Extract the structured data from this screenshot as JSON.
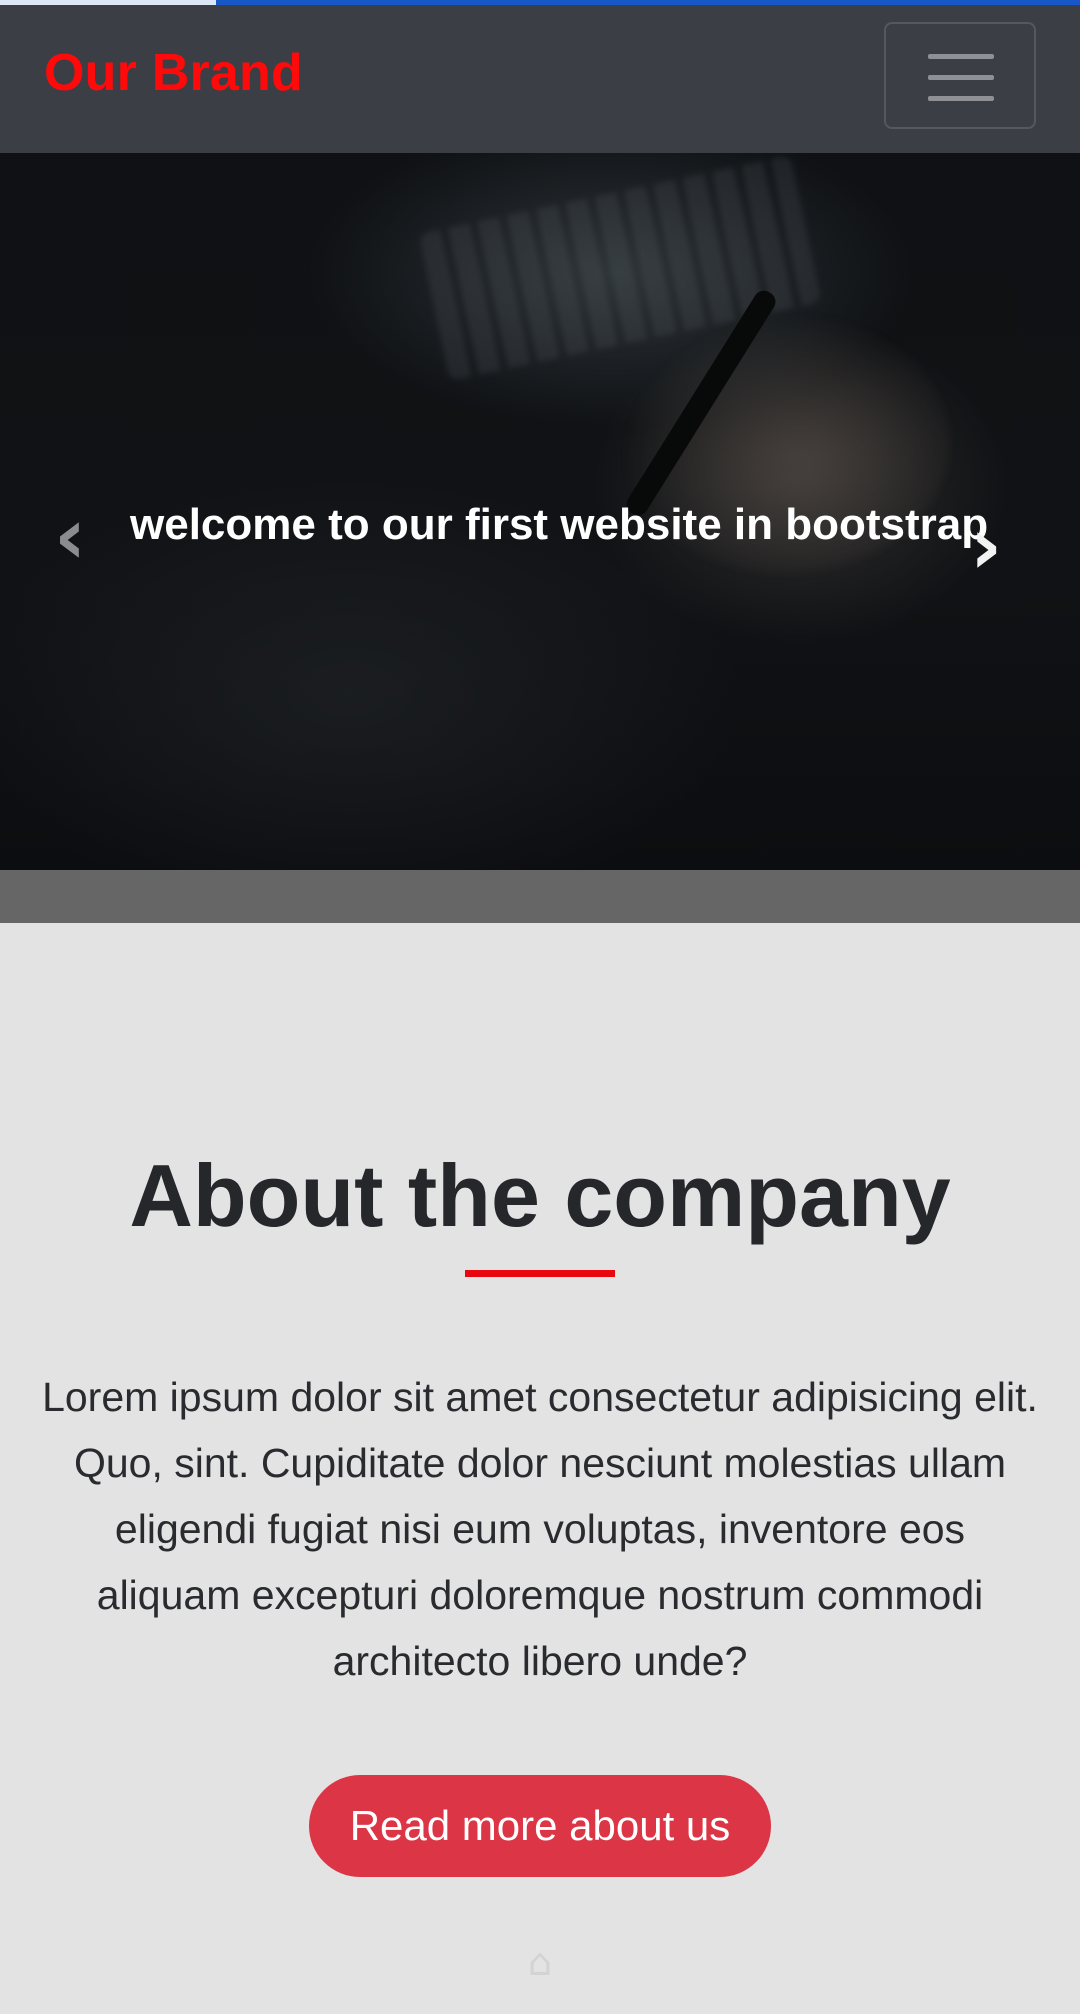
{
  "page_loader": {
    "progress": 0.2
  },
  "navbar": {
    "brand": "Our Brand",
    "brand_color": "#ff0a0a",
    "menu_toggle_icon": "hamburger-icon"
  },
  "carousel": {
    "caption": "welcome to our first website in bootstrap",
    "prev_icon": "chevron-left-icon",
    "prev_glyph": "‹",
    "next_icon": "chevron-right-icon",
    "next_glyph": "›"
  },
  "about": {
    "title": "About the company",
    "accent_color": "#e8060f",
    "text": "Lorem ipsum dolor sit amet consectetur adipisicing elit. Quo, sint. Cupiditate dolor nesciunt molestias ullam eligendi fugiat nisi eum voluptas, inventore eos aliquam excepturi doloremque nostrum commodi architecto libero unde?",
    "button_label": "Read more about us",
    "button_color": "#dc3545"
  },
  "watermark": {
    "icon": "site-logo-watermark"
  }
}
